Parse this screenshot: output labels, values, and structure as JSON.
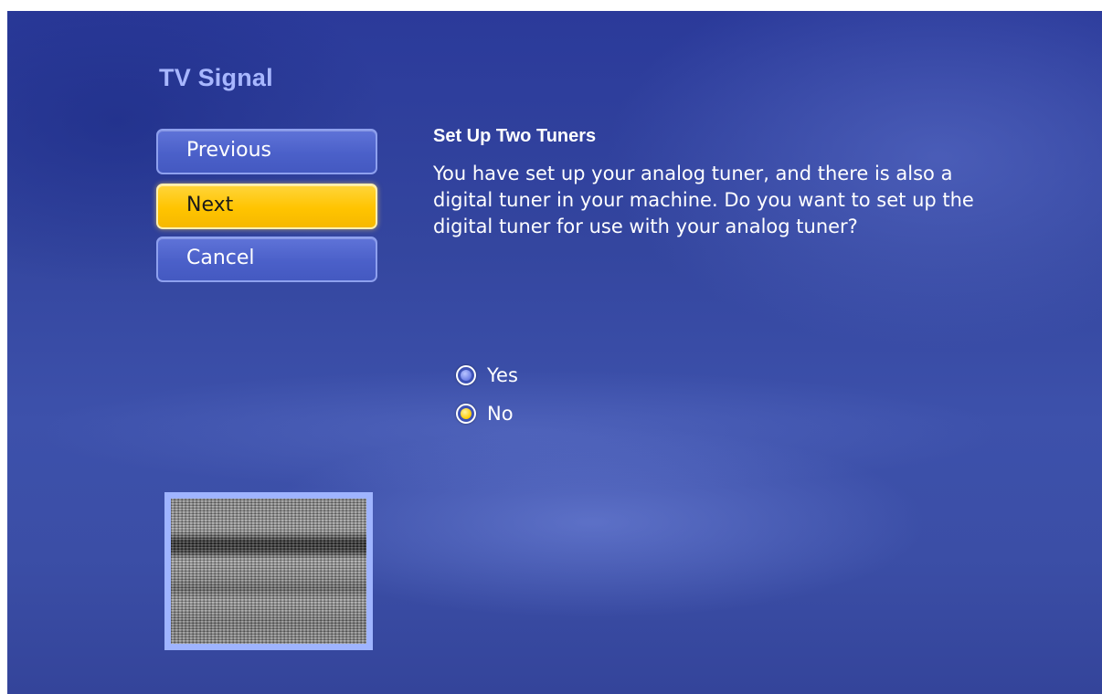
{
  "app": {
    "title": "TV Signal"
  },
  "nav": {
    "buttons": [
      {
        "label": "Previous"
      },
      {
        "label": "Next"
      },
      {
        "label": "Cancel"
      }
    ]
  },
  "content": {
    "heading": "Set Up Two Tuners",
    "body": "You have set up your analog tuner, and there is also a digital tuner in your machine. Do you want to set up the digital tuner for use with your analog tuner?"
  },
  "options": [
    {
      "label": "Yes",
      "selected": false
    },
    {
      "label": "No",
      "selected": true
    }
  ],
  "colors": {
    "background": "#34469f",
    "title": "#a8b7ff",
    "button": "#4b60c9",
    "focus": "#ffc400",
    "preview_border": "#9fb4ff"
  },
  "icons": {
    "preview": "tv-static-preview"
  }
}
